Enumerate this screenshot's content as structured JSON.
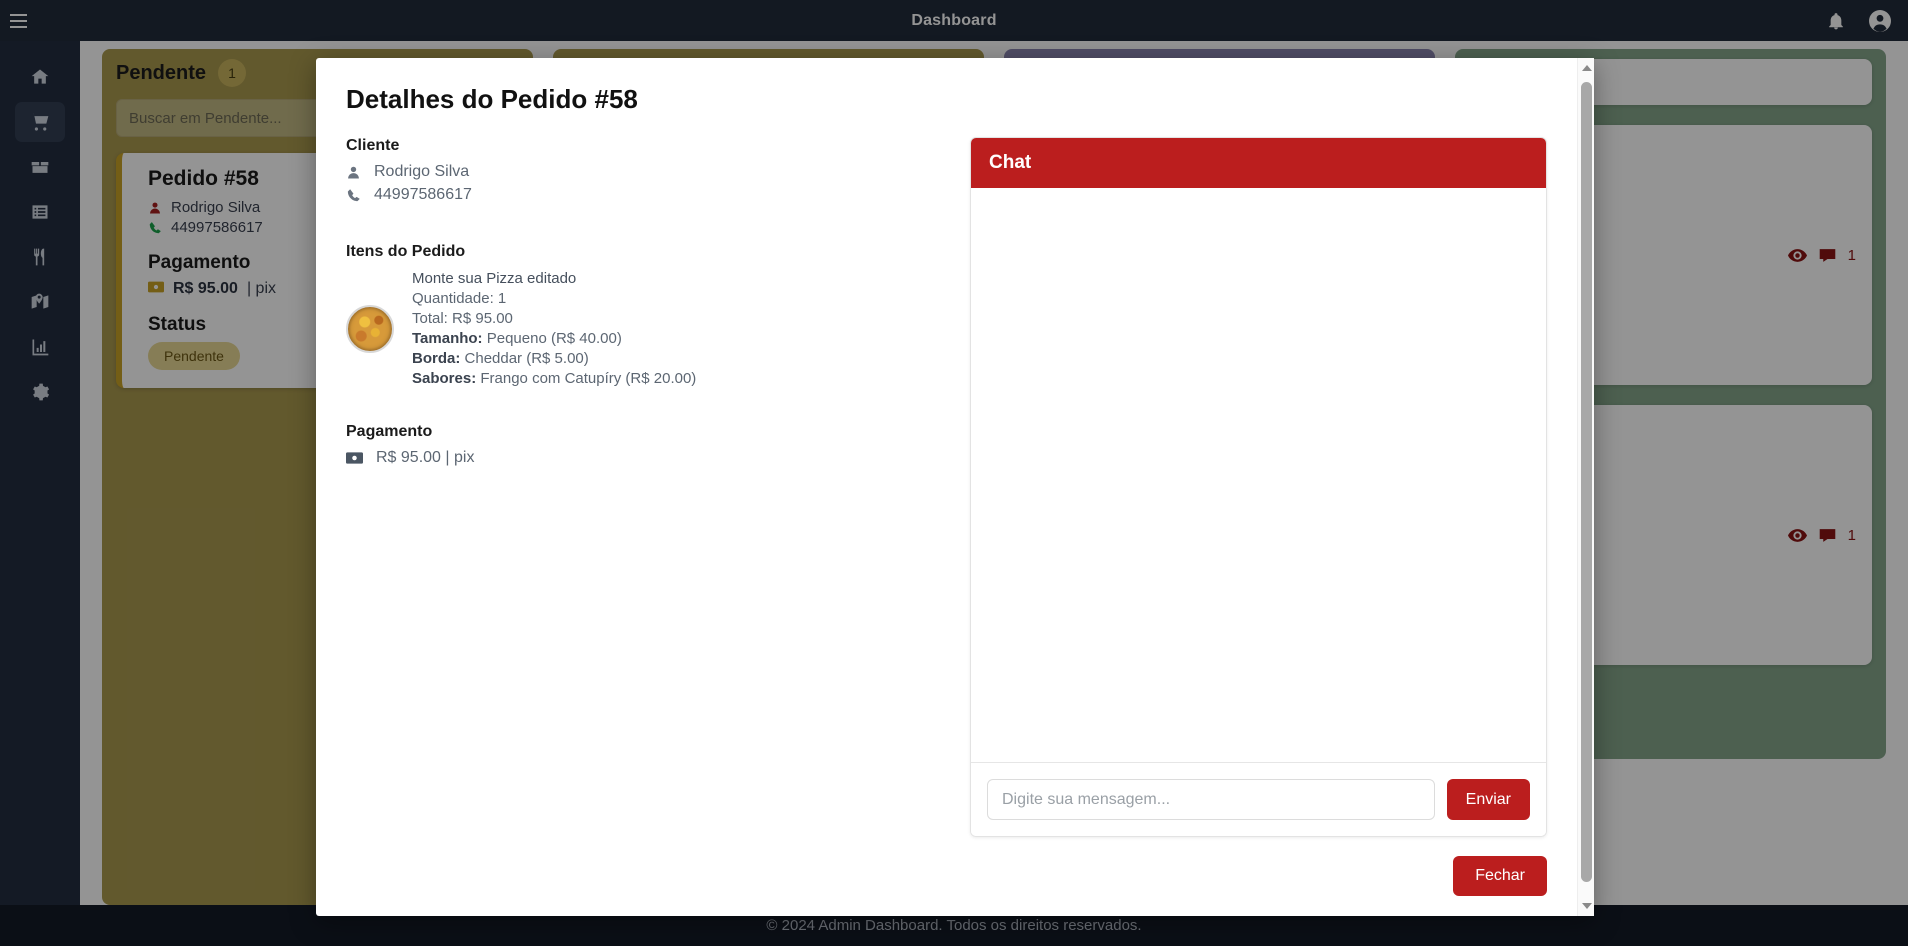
{
  "topbar": {
    "title": "Dashboard",
    "menu_icon": "hamburger-icon",
    "bell_icon": "bell-icon",
    "user_icon": "user-circle-icon"
  },
  "sidebar": {
    "items": [
      {
        "icon": "home-icon",
        "name": "home",
        "active": false
      },
      {
        "icon": "shopping-cart-icon",
        "name": "orders",
        "active": true
      },
      {
        "icon": "box-icon",
        "name": "products",
        "active": false
      },
      {
        "icon": "list-icon",
        "name": "categories",
        "active": false
      },
      {
        "icon": "utensils-icon",
        "name": "menu",
        "active": false
      },
      {
        "icon": "map-marker-icon",
        "name": "delivery",
        "active": false
      },
      {
        "icon": "chart-bar-icon",
        "name": "reports",
        "active": false
      },
      {
        "icon": "gear-icon",
        "name": "settings",
        "active": false
      }
    ]
  },
  "board": {
    "columns": [
      {
        "title": "Pendente",
        "count": "1",
        "search_placeholder": "Buscar em Pendente...",
        "accent": "#c9a227",
        "bg": "#a9994f",
        "order": {
          "title": "Pedido #58",
          "customer": "Rodrigo Silva",
          "phone": "44997586617",
          "payment_heading": "Pagamento",
          "payment_amount": "R$ 95.00",
          "payment_sep": "| pix",
          "status_heading": "Status",
          "status_badge": "Pendente"
        }
      },
      {
        "title": "",
        "count": "",
        "search_placeholder": "",
        "bg": "#a9994f"
      },
      {
        "title": "",
        "count": "",
        "search_placeholder": "",
        "bg": "#8b86b0"
      },
      {
        "title": "",
        "count": "",
        "search_placeholder": "",
        "bg": "#85a68b"
      }
    ],
    "card_actions": {
      "view_icon": "eye-icon",
      "comment_icon": "comment-icon",
      "comment_count": "1"
    }
  },
  "modal": {
    "title": "Detalhes do Pedido #58",
    "customer_section": {
      "heading": "Cliente",
      "person_icon": "user-icon",
      "name": "Rodrigo Silva",
      "phone_icon": "phone-icon",
      "phone": "44997586617"
    },
    "items_section": {
      "heading": "Itens do Pedido",
      "item": {
        "thumb": "pizza-thumbnail",
        "name": "Monte sua Pizza editado",
        "quantity": "Quantidade: 1",
        "total": "Total: R$ 95.00",
        "size_label": "Tamanho:",
        "size_value": "Pequeno (R$ 40.00)",
        "border_label": "Borda:",
        "border_value": "Cheddar (R$ 5.00)",
        "flavors_label": "Sabores:",
        "flavors_value": "Frango com Catupíry (R$ 20.00)"
      }
    },
    "payment_section": {
      "heading": "Pagamento",
      "money_icon": "money-bill-icon",
      "value": "R$ 95.00 | pix"
    },
    "chat": {
      "heading": "Chat",
      "input_placeholder": "Digite sua mensagem...",
      "send_label": "Enviar",
      "messages": []
    },
    "close_label": "Fechar",
    "scrollbar": {
      "up_icon": "caret-up-icon",
      "down_icon": "caret-down-icon"
    }
  },
  "footer": {
    "text": "© 2024 Admin Dashboard. Todos os direitos reservados."
  },
  "colors": {
    "brand_red": "#bb1e1e",
    "sidebar_bg": "#242e40",
    "topbar_bg": "#212b3b",
    "footer_bg": "#141a26",
    "pending_accent": "#c9a227"
  }
}
